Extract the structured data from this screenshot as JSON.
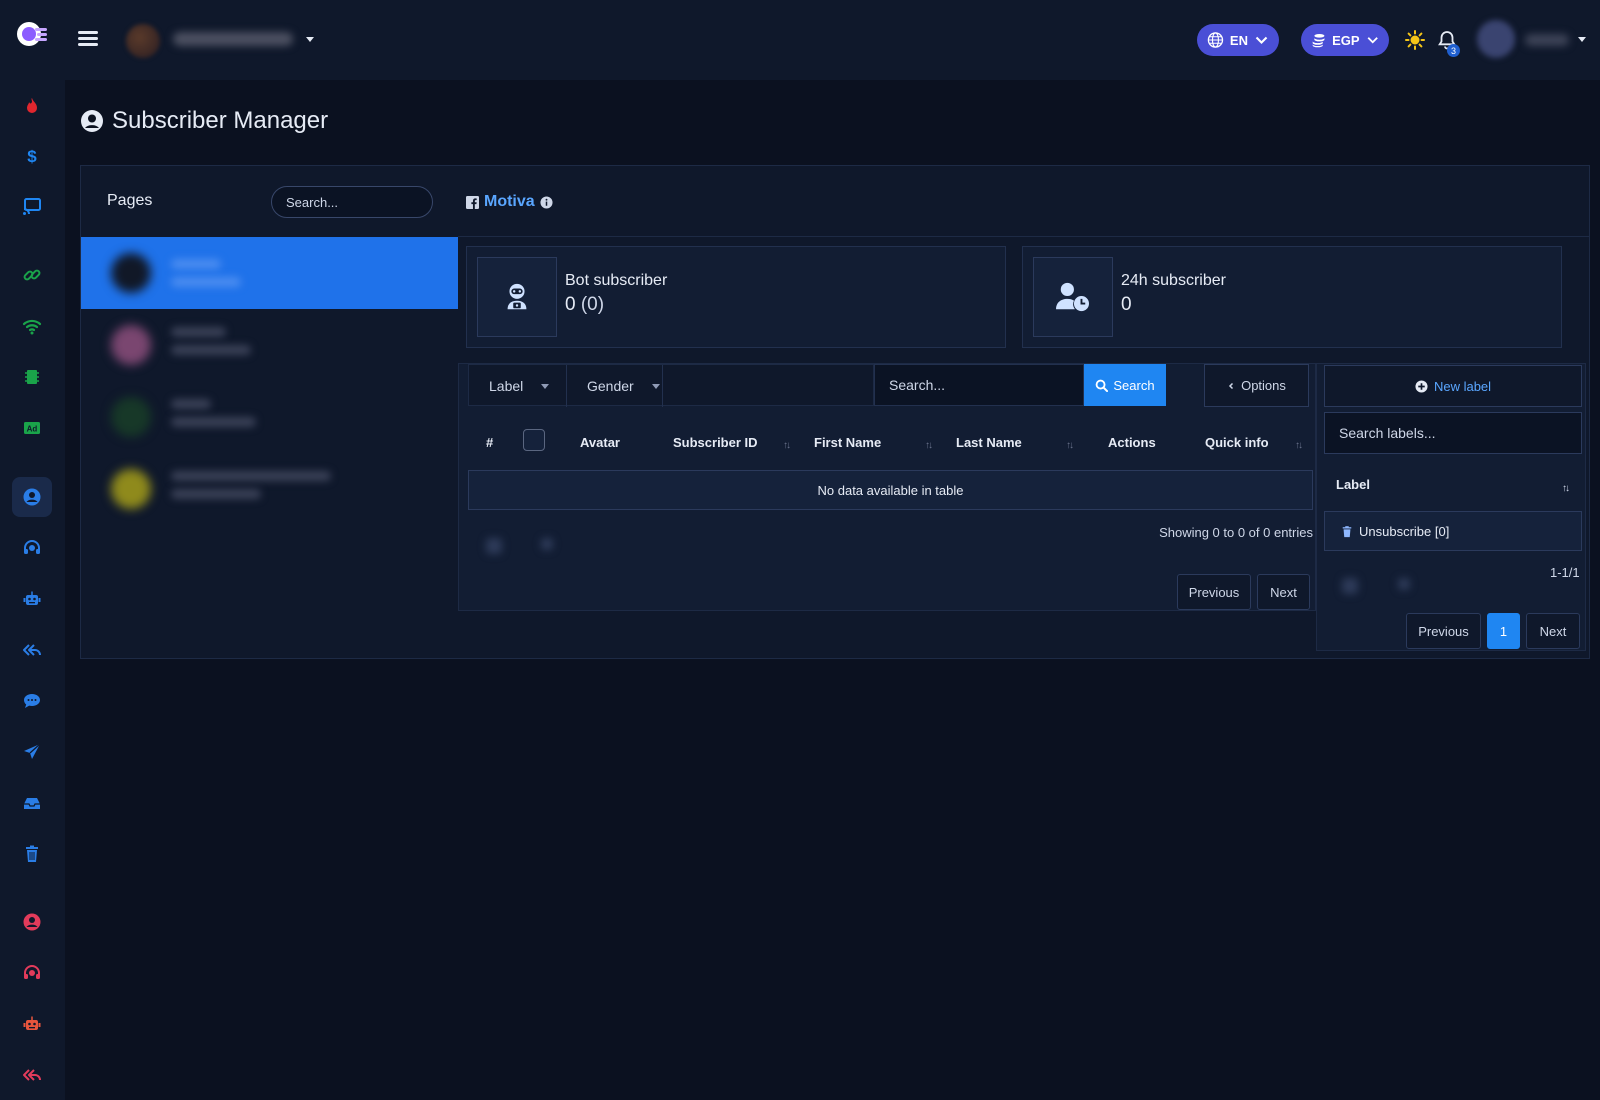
{
  "header": {
    "language": "EN",
    "currency": "EGP",
    "notification_count": "3"
  },
  "page": {
    "title": "Subscriber Manager"
  },
  "pages_panel": {
    "label": "Pages",
    "search_placeholder": "Search..."
  },
  "page_name": "Motiva",
  "stats": [
    {
      "label": "Bot subscriber",
      "value": "0",
      "sub": "(0)"
    },
    {
      "label": "24h subscriber",
      "value": "0"
    }
  ],
  "filters": {
    "label": "Label",
    "gender": "Gender",
    "search_placeholder": "Search...",
    "search_button": "Search",
    "options_button": "Options"
  },
  "table": {
    "columns": [
      "#",
      "Avatar",
      "Subscriber ID",
      "First Name",
      "Last Name",
      "Actions",
      "Quick info"
    ],
    "empty": "No data available in table",
    "showing": "Showing 0 to 0 of 0 entries",
    "previous": "Previous",
    "next": "Next"
  },
  "labels": {
    "new_label": "New label",
    "search_placeholder": "Search labels...",
    "column": "Label",
    "items": [
      "Unsubscribe [0]"
    ],
    "range": "1-1/1",
    "previous": "Previous",
    "current_page": "1",
    "next": "Next"
  },
  "colors": {
    "accent": "#1f86f2",
    "pill": "#4a4fd6",
    "background": "#0b1120"
  }
}
